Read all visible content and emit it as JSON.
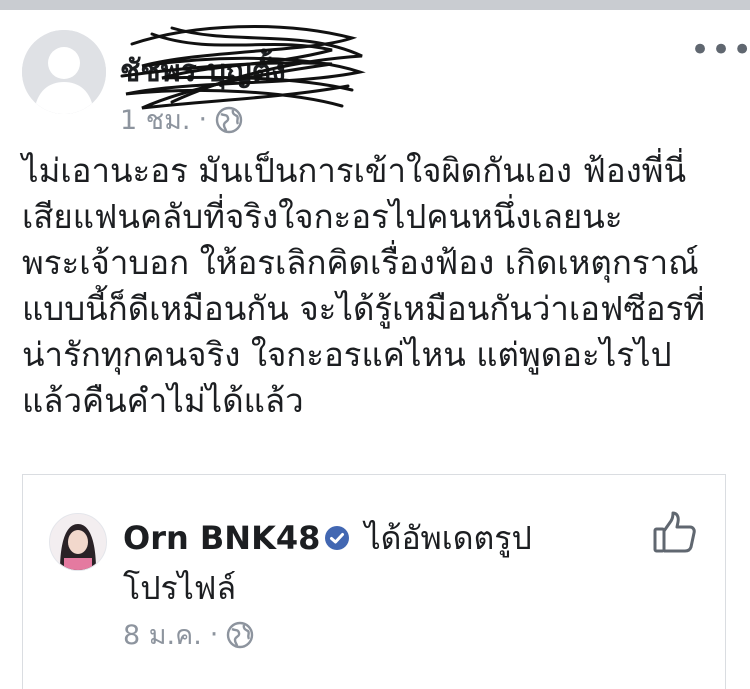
{
  "post": {
    "author_name": "ชัชพร บุญตั้ง",
    "time": "1 ชม.",
    "separator": "·",
    "more_label": "•••",
    "lines": [
      "ไม่เอานะอร มันเป็นการเข้าใจผิดกันเอง ฟ้องพี่นี่",
      "เสียแฟนคลับที่จริงใจกะอรไปคนหนึ่งเลยนะ",
      "พระเจ้าบอก ให้อรเลิกคิดเรื่องฟ้อง เกิดเหตุกราณ์",
      "แบบนี้ก็ดีเหมือนกัน จะได้รู้เหมือนกันว่าเอฟซีอรที่",
      "น่ารักทุกคนจริง ใจกะอรแค่ไหน แต่พูดอะไรไป",
      "แล้วคืนคำไม่ได้แล้ว"
    ]
  },
  "shared_card": {
    "page_name": "Orn BNK48",
    "action_text": "ได้อัพเดตรูป",
    "action_text_2": "โปรไฟล์",
    "time": "8 ม.ค.",
    "separator": "·"
  }
}
